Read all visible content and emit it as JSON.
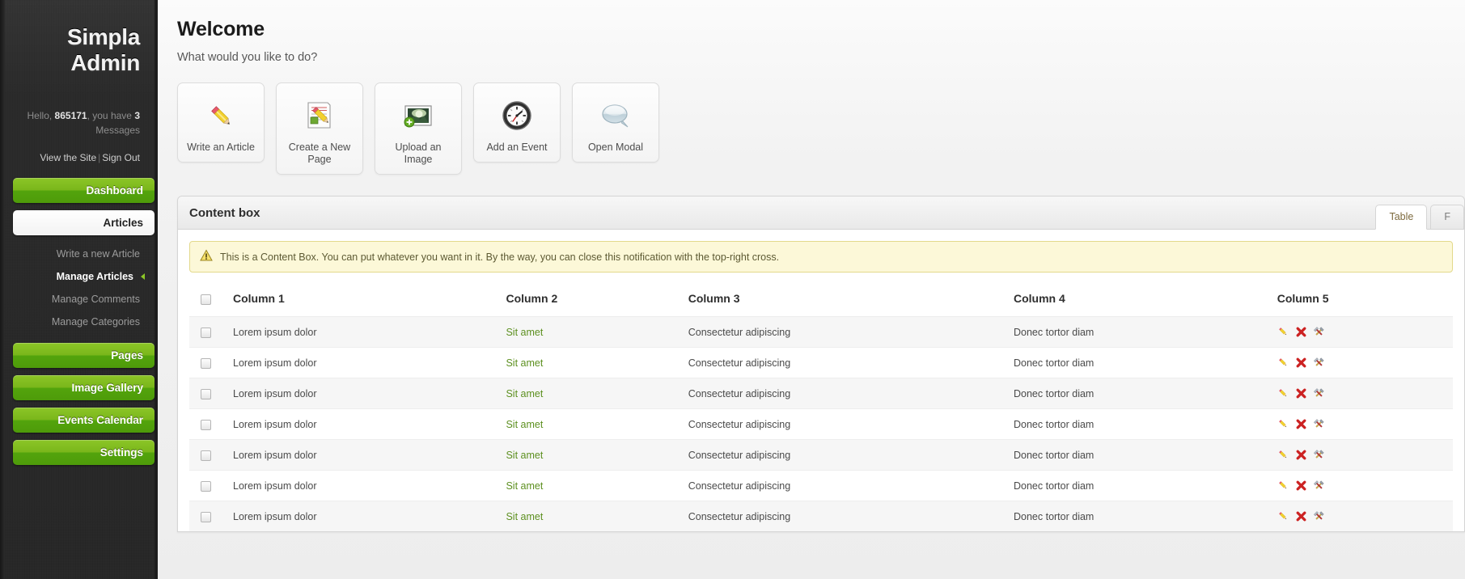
{
  "sidebar": {
    "brand": "Simpla Admin",
    "greeting": {
      "hello": "Hello,",
      "user": "865171",
      "middle": ", you have",
      "count": "3",
      "suffix": "Messages"
    },
    "links": {
      "view_site": "View the Site",
      "separator": "|",
      "sign_out": "Sign Out"
    },
    "nav": [
      {
        "label": "Dashboard",
        "style": "green"
      },
      {
        "label": "Articles",
        "style": "white"
      },
      {
        "label": "Pages",
        "style": "green"
      },
      {
        "label": "Image Gallery",
        "style": "green"
      },
      {
        "label": "Events Calendar",
        "style": "green"
      },
      {
        "label": "Settings",
        "style": "green"
      }
    ],
    "subnav": [
      {
        "label": "Write a new Article",
        "current": false
      },
      {
        "label": "Manage Articles",
        "current": true
      },
      {
        "label": "Manage Comments",
        "current": false
      },
      {
        "label": "Manage Categories",
        "current": false
      }
    ]
  },
  "main": {
    "title": "Welcome",
    "subtitle": "What would you like to do?",
    "shortcuts": [
      {
        "label": "Write an Article",
        "icon": "pencil-icon"
      },
      {
        "label": "Create a New Page",
        "icon": "page-edit-icon"
      },
      {
        "label": "Upload an Image",
        "icon": "image-add-icon"
      },
      {
        "label": "Add an Event",
        "icon": "clock-icon"
      },
      {
        "label": "Open Modal",
        "icon": "speech-bubble-icon"
      }
    ]
  },
  "content_box": {
    "title": "Content box",
    "tabs": [
      {
        "label": "Table",
        "active": true
      },
      {
        "label": "F",
        "active": false
      }
    ],
    "notice": {
      "icon": "warning-icon",
      "text": "This is a Content Box. You can put whatever you want in it. By the way, you can close this notification with the top-right cross."
    },
    "table": {
      "headers": [
        "Column 1",
        "Column 2",
        "Column 3",
        "Column 4",
        "Column 5"
      ],
      "rows": [
        {
          "c1": "Lorem ipsum dolor",
          "c2": "Sit amet",
          "c3": "Consectetur adipiscing",
          "c4": "Donec tortor diam"
        },
        {
          "c1": "Lorem ipsum dolor",
          "c2": "Sit amet",
          "c3": "Consectetur adipiscing",
          "c4": "Donec tortor diam"
        },
        {
          "c1": "Lorem ipsum dolor",
          "c2": "Sit amet",
          "c3": "Consectetur adipiscing",
          "c4": "Donec tortor diam"
        },
        {
          "c1": "Lorem ipsum dolor",
          "c2": "Sit amet",
          "c3": "Consectetur adipiscing",
          "c4": "Donec tortor diam"
        },
        {
          "c1": "Lorem ipsum dolor",
          "c2": "Sit amet",
          "c3": "Consectetur adipiscing",
          "c4": "Donec tortor diam"
        },
        {
          "c1": "Lorem ipsum dolor",
          "c2": "Sit amet",
          "c3": "Consectetur adipiscing",
          "c4": "Donec tortor diam"
        },
        {
          "c1": "Lorem ipsum dolor",
          "c2": "Sit amet",
          "c3": "Consectetur adipiscing",
          "c4": "Donec tortor diam"
        }
      ],
      "row_actions": [
        "edit-icon",
        "delete-icon",
        "tools-icon"
      ]
    }
  },
  "colors": {
    "green": "#7ab71b",
    "link_green": "#5d9020",
    "notice_bg": "#fcf8d8",
    "sidebar_bg": "#2b2b2b"
  }
}
